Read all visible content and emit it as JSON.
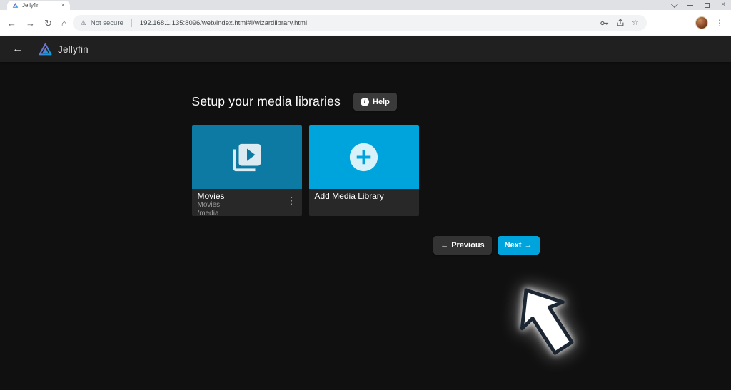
{
  "browser": {
    "tab": {
      "title": "Jellyfin"
    },
    "address": {
      "security_warning": "Not secure",
      "url": "192.168.1.135:8096/web/index.html#!/wizardlibrary.html"
    }
  },
  "app": {
    "header": {
      "brand": "Jellyfin"
    },
    "page": {
      "title": "Setup your media libraries",
      "help_label": "Help",
      "cards": [
        {
          "name": "Movies",
          "subtitle": "Movies",
          "path": "/media"
        },
        {
          "name": "Add Media Library"
        }
      ],
      "buttons": {
        "previous": "Previous",
        "next": "Next"
      }
    }
  },
  "icons": {
    "back_nav": "←",
    "forward_nav": "→",
    "reload": "↻",
    "home": "⌂",
    "warning": "⚠",
    "star": "☆",
    "menu_dots": "⋮",
    "tab_close": "×",
    "win_close": "×",
    "app_back": "←",
    "card_menu": "⋮",
    "arrow_left": "←",
    "arrow_right": "→",
    "info": "i"
  },
  "colors": {
    "accent": "#00a4dc",
    "movies_card": "#0d7aa4",
    "page_bg": "#101010",
    "header_bg": "#202020",
    "card_footer": "#282828"
  }
}
